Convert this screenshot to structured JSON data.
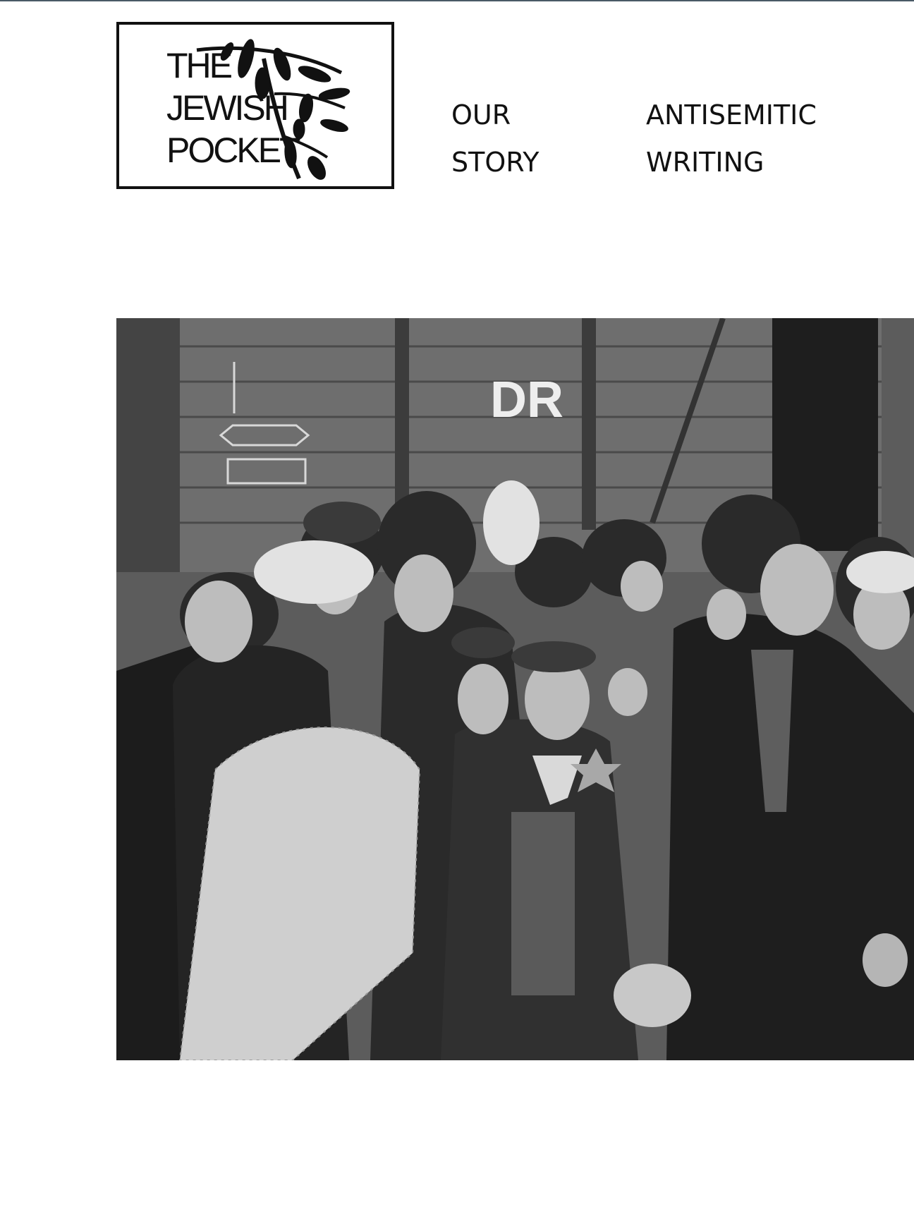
{
  "header": {
    "logo": {
      "line1": "THE",
      "line2": "JEWISH",
      "line3": "POCKET"
    },
    "nav": [
      {
        "line1": "OUR",
        "line2": "STORY"
      },
      {
        "line1": "ANTISEMITIC",
        "line2": "WRITING"
      }
    ]
  },
  "hero": {
    "wagon_marking": "DR"
  }
}
